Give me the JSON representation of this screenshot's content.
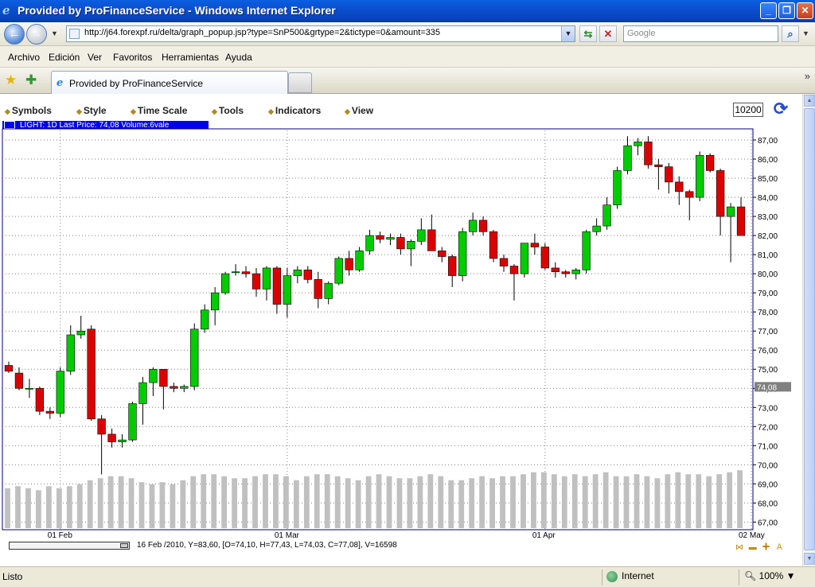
{
  "window": {
    "title": "Provided by ProFinanceService - Windows Internet Explorer",
    "caption_buttons": [
      "_",
      "❐",
      "✕"
    ]
  },
  "nav": {
    "url": "http://j64.forexpf.ru/delta/graph_popup.jsp?type=SnP500&grtype=2&tictype=0&amount=335",
    "search_placeholder": "Google"
  },
  "menu": [
    "Archivo",
    "Edición",
    "Ver",
    "Favoritos",
    "Herramientas",
    "Ayuda"
  ],
  "tab": {
    "label": "Provided by ProFinanceService"
  },
  "toolbar": {
    "items": [
      "Symbols",
      "Style",
      "Time Scale",
      "Tools",
      "Indicators",
      "View"
    ],
    "amount": "10200"
  },
  "chart_header": "LIGHT: 1D Last Price: 74,08 Volume:6vale",
  "chart_data": {
    "type": "candlestick",
    "title": "",
    "ylim": [
      66.6,
      87.5
    ],
    "y_ticks": [
      "87,00",
      "86,00",
      "85,00",
      "84,00",
      "83,00",
      "82,00",
      "81,00",
      "80,00",
      "79,00",
      "78,00",
      "77,00",
      "76,00",
      "75,00",
      "74,00",
      "73,00",
      "72,00",
      "71,00",
      "70,00",
      "69,00",
      "68,00",
      "67,00"
    ],
    "x_ticks": [
      "01 Feb",
      "01 Mar",
      "01 Apr",
      "02 May"
    ],
    "x_tick_index": [
      5,
      27,
      52,
      72
    ],
    "last_price_label": "74,08",
    "last_price": 74.08,
    "grid": true,
    "colors": {
      "up": "#00cc00",
      "down": "#dd0000",
      "volume": "#c0c0c0",
      "grid": "#808080"
    },
    "candles": [
      {
        "o": 75.2,
        "h": 75.4,
        "l": 74.8,
        "c": 74.9
      },
      {
        "o": 74.8,
        "h": 75.1,
        "l": 73.9,
        "c": 74.0
      },
      {
        "o": 74.0,
        "h": 74.5,
        "l": 73.5,
        "c": 74.0
      },
      {
        "o": 74.0,
        "h": 74.1,
        "l": 72.6,
        "c": 72.8
      },
      {
        "o": 72.8,
        "h": 73.0,
        "l": 72.4,
        "c": 72.7
      },
      {
        "o": 72.7,
        "h": 75.1,
        "l": 72.5,
        "c": 74.9
      },
      {
        "o": 74.9,
        "h": 77.3,
        "l": 74.7,
        "c": 76.8
      },
      {
        "o": 76.8,
        "h": 77.8,
        "l": 76.6,
        "c": 77.0
      },
      {
        "o": 77.1,
        "h": 77.3,
        "l": 72.3,
        "c": 72.4
      },
      {
        "o": 72.4,
        "h": 72.6,
        "l": 69.5,
        "c": 71.6
      },
      {
        "o": 71.6,
        "h": 71.9,
        "l": 70.9,
        "c": 71.2
      },
      {
        "o": 71.2,
        "h": 71.6,
        "l": 70.9,
        "c": 71.3
      },
      {
        "o": 71.3,
        "h": 73.3,
        "l": 71.2,
        "c": 73.2
      },
      {
        "o": 73.2,
        "h": 74.6,
        "l": 72.1,
        "c": 74.3
      },
      {
        "o": 74.3,
        "h": 75.1,
        "l": 73.6,
        "c": 75.0
      },
      {
        "o": 75.0,
        "h": 75.0,
        "l": 72.9,
        "c": 74.1
      },
      {
        "o": 74.1,
        "h": 74.3,
        "l": 73.8,
        "c": 74.0
      },
      {
        "o": 74.0,
        "h": 74.2,
        "l": 73.8,
        "c": 74.1
      },
      {
        "o": 74.1,
        "h": 77.4,
        "l": 73.9,
        "c": 77.1
      },
      {
        "o": 77.1,
        "h": 78.4,
        "l": 76.9,
        "c": 78.1
      },
      {
        "o": 78.1,
        "h": 79.3,
        "l": 77.3,
        "c": 79.0
      },
      {
        "o": 79.0,
        "h": 80.1,
        "l": 78.9,
        "c": 80.0
      },
      {
        "o": 80.1,
        "h": 80.5,
        "l": 79.9,
        "c": 80.1
      },
      {
        "o": 80.1,
        "h": 80.4,
        "l": 79.8,
        "c": 80.0
      },
      {
        "o": 80.0,
        "h": 80.3,
        "l": 78.8,
        "c": 79.2
      },
      {
        "o": 79.2,
        "h": 80.4,
        "l": 78.6,
        "c": 80.3
      },
      {
        "o": 80.3,
        "h": 80.4,
        "l": 77.9,
        "c": 78.4
      },
      {
        "o": 78.4,
        "h": 80.3,
        "l": 77.7,
        "c": 79.9
      },
      {
        "o": 79.9,
        "h": 80.4,
        "l": 79.5,
        "c": 80.2
      },
      {
        "o": 80.2,
        "h": 80.4,
        "l": 79.5,
        "c": 79.7
      },
      {
        "o": 79.7,
        "h": 80.1,
        "l": 78.2,
        "c": 78.7
      },
      {
        "o": 78.7,
        "h": 79.6,
        "l": 78.4,
        "c": 79.5
      },
      {
        "o": 79.5,
        "h": 80.9,
        "l": 79.4,
        "c": 80.8
      },
      {
        "o": 80.8,
        "h": 81.2,
        "l": 79.9,
        "c": 80.2
      },
      {
        "o": 80.2,
        "h": 81.4,
        "l": 80.1,
        "c": 81.2
      },
      {
        "o": 81.2,
        "h": 82.3,
        "l": 81.0,
        "c": 82.0
      },
      {
        "o": 82.0,
        "h": 82.2,
        "l": 81.6,
        "c": 81.8
      },
      {
        "o": 81.8,
        "h": 82.1,
        "l": 81.5,
        "c": 81.9
      },
      {
        "o": 81.9,
        "h": 82.1,
        "l": 81.0,
        "c": 81.3
      },
      {
        "o": 81.3,
        "h": 81.8,
        "l": 80.4,
        "c": 81.7
      },
      {
        "o": 81.7,
        "h": 82.9,
        "l": 81.5,
        "c": 82.3
      },
      {
        "o": 82.3,
        "h": 83.1,
        "l": 81.7,
        "c": 81.2
      },
      {
        "o": 81.2,
        "h": 81.4,
        "l": 80.6,
        "c": 80.9
      },
      {
        "o": 80.9,
        "h": 81.0,
        "l": 79.3,
        "c": 79.9
      },
      {
        "o": 79.9,
        "h": 82.4,
        "l": 79.6,
        "c": 82.2
      },
      {
        "o": 82.2,
        "h": 83.2,
        "l": 82.0,
        "c": 82.8
      },
      {
        "o": 82.8,
        "h": 83.0,
        "l": 82.0,
        "c": 82.2
      },
      {
        "o": 82.2,
        "h": 82.3,
        "l": 80.6,
        "c": 80.8
      },
      {
        "o": 80.8,
        "h": 81.0,
        "l": 80.1,
        "c": 80.4
      },
      {
        "o": 80.4,
        "h": 80.5,
        "l": 78.6,
        "c": 80.0
      },
      {
        "o": 80.0,
        "h": 81.6,
        "l": 79.8,
        "c": 81.6
      },
      {
        "o": 81.6,
        "h": 82.1,
        "l": 81.0,
        "c": 81.4
      },
      {
        "o": 81.4,
        "h": 81.6,
        "l": 80.2,
        "c": 80.3
      },
      {
        "o": 80.3,
        "h": 80.6,
        "l": 79.8,
        "c": 80.1
      },
      {
        "o": 80.1,
        "h": 80.2,
        "l": 79.8,
        "c": 80.0
      },
      {
        "o": 80.0,
        "h": 80.3,
        "l": 79.7,
        "c": 80.2
      },
      {
        "o": 80.2,
        "h": 82.3,
        "l": 80.0,
        "c": 82.2
      },
      {
        "o": 82.2,
        "h": 82.9,
        "l": 82.0,
        "c": 82.5
      },
      {
        "o": 82.5,
        "h": 84.0,
        "l": 82.3,
        "c": 83.6
      },
      {
        "o": 83.6,
        "h": 85.6,
        "l": 83.4,
        "c": 85.4
      },
      {
        "o": 85.4,
        "h": 87.2,
        "l": 85.2,
        "c": 86.7
      },
      {
        "o": 86.7,
        "h": 87.1,
        "l": 86.2,
        "c": 86.9
      },
      {
        "o": 86.9,
        "h": 87.2,
        "l": 85.5,
        "c": 85.7
      },
      {
        "o": 85.7,
        "h": 86.0,
        "l": 84.4,
        "c": 85.6
      },
      {
        "o": 85.6,
        "h": 85.8,
        "l": 84.2,
        "c": 84.8
      },
      {
        "o": 84.8,
        "h": 85.1,
        "l": 83.6,
        "c": 84.3
      },
      {
        "o": 84.3,
        "h": 84.4,
        "l": 82.8,
        "c": 84.0
      },
      {
        "o": 84.0,
        "h": 86.4,
        "l": 83.8,
        "c": 86.2
      },
      {
        "o": 86.2,
        "h": 86.3,
        "l": 85.3,
        "c": 85.4
      },
      {
        "o": 85.4,
        "h": 85.5,
        "l": 82.0,
        "c": 83.0
      },
      {
        "o": 83.0,
        "h": 83.7,
        "l": 80.6,
        "c": 83.5
      },
      {
        "o": 83.5,
        "h": 84.0,
        "l": 82.1,
        "c": 82.0
      }
    ],
    "volumes": [
      0.2,
      0.21,
      0.2,
      0.19,
      0.21,
      0.2,
      0.21,
      0.22,
      0.24,
      0.25,
      0.26,
      0.26,
      0.25,
      0.23,
      0.22,
      0.23,
      0.22,
      0.24,
      0.26,
      0.27,
      0.27,
      0.26,
      0.25,
      0.25,
      0.26,
      0.27,
      0.27,
      0.26,
      0.24,
      0.26,
      0.27,
      0.27,
      0.26,
      0.25,
      0.24,
      0.26,
      0.27,
      0.26,
      0.25,
      0.25,
      0.26,
      0.27,
      0.26,
      0.24,
      0.24,
      0.25,
      0.26,
      0.25,
      0.26,
      0.26,
      0.27,
      0.28,
      0.28,
      0.27,
      0.26,
      0.27,
      0.26,
      0.27,
      0.28,
      0.26,
      0.26,
      0.27,
      0.26,
      0.25,
      0.27,
      0.28,
      0.27,
      0.27,
      0.26,
      0.27,
      0.28,
      0.29
    ]
  },
  "chart_status": "16 Feb /2010, Y=83,60, [O=74,10, H=77,43, L=74,03, C=77,08], V=16598",
  "statusbar": {
    "left": "Listo",
    "zone": "Internet",
    "zoom": "100%"
  }
}
